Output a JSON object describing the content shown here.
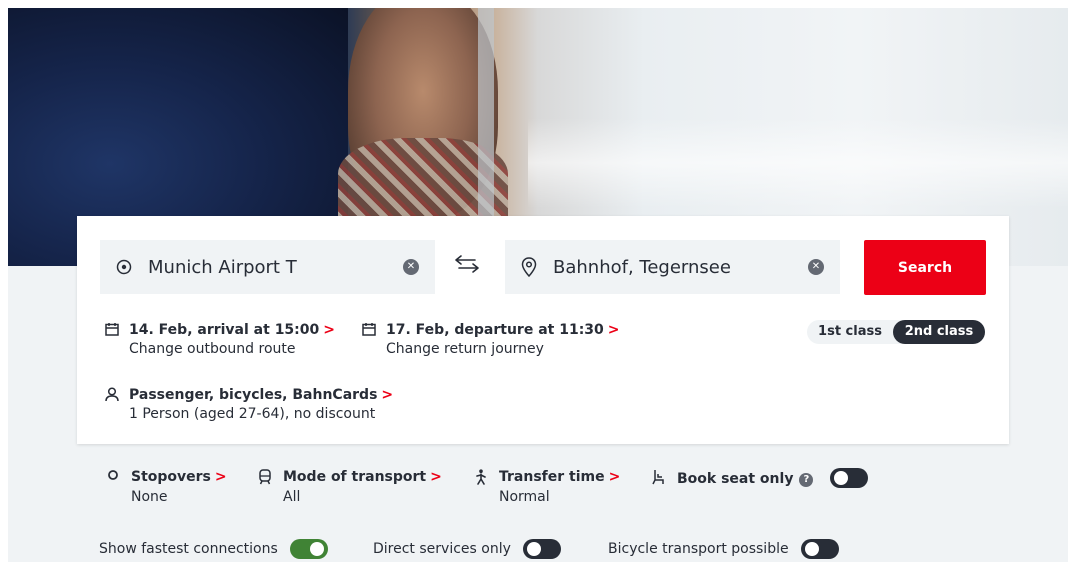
{
  "search": {
    "from_value": "Munich Airport T",
    "to_value": "Bahnhof, Tegernsee",
    "search_label": "Search"
  },
  "outbound": {
    "title": "14. Feb, arrival at 15:00",
    "subtitle": "Change outbound route"
  },
  "return": {
    "title": "17. Feb, departure at 11:30",
    "subtitle": "Change return journey"
  },
  "passengers": {
    "title": "Passenger, bicycles, BahnCards",
    "subtitle": "1 Person (aged 27-64), no discount"
  },
  "travel_class": {
    "first": "1st class",
    "second": "2nd class",
    "selected": "2nd class"
  },
  "options": {
    "stopovers": {
      "title": "Stopovers",
      "value": "None"
    },
    "transport": {
      "title": "Mode of transport",
      "value": "All"
    },
    "transfer": {
      "title": "Transfer time",
      "value": "Normal"
    },
    "seat_only": {
      "title": "Book seat only",
      "help": "?",
      "enabled": false
    }
  },
  "filters": {
    "fastest": {
      "label": "Show fastest connections",
      "enabled": true
    },
    "direct": {
      "label": "Direct services only",
      "enabled": false
    },
    "bicycle": {
      "label": "Bicycle transport possible",
      "enabled": false
    }
  },
  "chevron": ">",
  "icons": {
    "from": "origin-target-icon",
    "to": "location-pin-icon",
    "swap": "swap-arrows-icon",
    "calendar": "calendar-icon",
    "person": "person-icon",
    "stopover": "stopover-circle-icon",
    "transport": "train-icon",
    "transfer": "walking-person-icon",
    "seat": "seat-icon",
    "clear": "clear-circle-icon"
  },
  "colors": {
    "accent": "#ec0016",
    "toggle_on": "#408335",
    "dark": "#282d37",
    "field_bg": "#f0f3f5"
  }
}
